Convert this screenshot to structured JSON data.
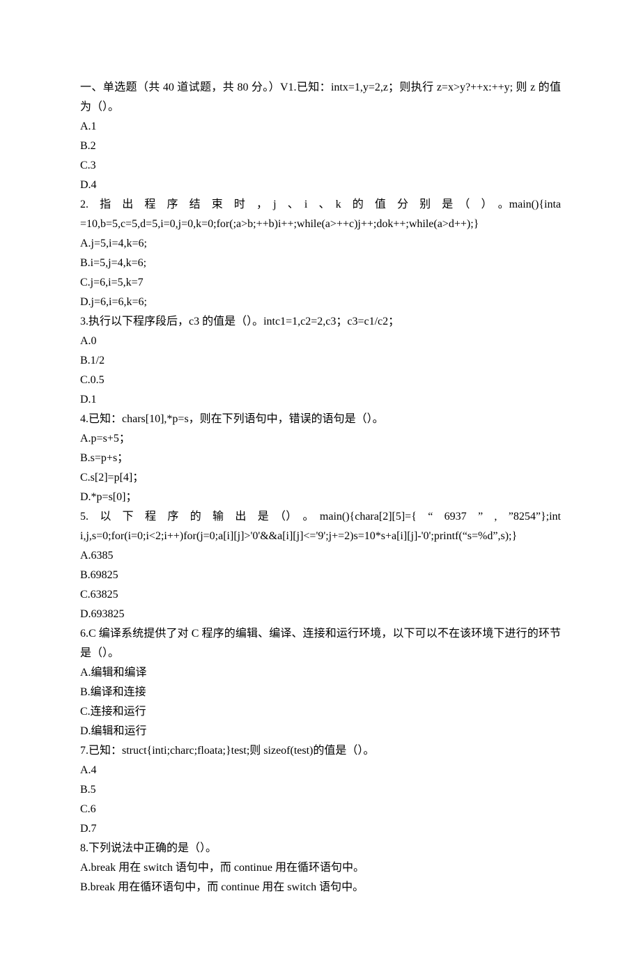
{
  "lines": [
    {
      "t": "一、单选题（共 40 道试题，共 80 分。）V1.已知：intx=1,y=2,z；则执行 z=x>y?++x:++y; 则 z 的值为（）。"
    },
    {
      "t": "A.1"
    },
    {
      "t": "B.2"
    },
    {
      "t": "C.3"
    },
    {
      "t": "D.4"
    },
    {
      "t": "2.　指　出　程　序　结　束　时　，　j　、　i　、　k　的　值　分　别　是　（　）　。main(){inta=10,b=5,c=5,d=5,i=0,j=0,k=0;for(;a>b;++b)i++;while(a>++c)j++;dok++;while(a>d++);}"
    },
    {
      "t": "A.j=5,i=4,k=6;"
    },
    {
      "t": "B.i=5,j=4,k=6;"
    },
    {
      "t": "C.j=6,i=5,k=7"
    },
    {
      "t": "D.j=6,i=6,k=6;"
    },
    {
      "t": "3.执行以下程序段后，c3 的值是（）。intc1=1,c2=2,c3；c3=c1/c2；"
    },
    {
      "t": "A.0"
    },
    {
      "t": "B.1/2"
    },
    {
      "t": "C.0.5"
    },
    {
      "t": "D.1"
    },
    {
      "t": "4.已知：chars[10],*p=s，则在下列语句中，错误的语句是（）。"
    },
    {
      "t": "A.p=s+5；"
    },
    {
      "t": "B.s=p+s；"
    },
    {
      "t": "C.s[2]=p[4]；"
    },
    {
      "t": "D.*p=s[0]；"
    },
    {
      "t": "5.　以　下　程　序　的　输　出　是　（）　。　main(){chara[2][5]={　“　6937　”　,　”8254”};inti,j,s=0;for(i=0;i<2;i++)for(j=0;a[i][j]>'0'&&a[i][j]<='9';j+=2)s=10*s+a[i][j]-'0';printf(“s=%d”,s);}"
    },
    {
      "t": "A.6385"
    },
    {
      "t": "B.69825"
    },
    {
      "t": "C.63825"
    },
    {
      "t": "D.693825"
    },
    {
      "t": "6.C 编译系统提供了对 C 程序的编辑、编译、连接和运行环境，以下可以不在该环境下进行的环节是（）。"
    },
    {
      "t": "A.编辑和编译"
    },
    {
      "t": "B.编译和连接"
    },
    {
      "t": "C.连接和运行"
    },
    {
      "t": "D.编辑和运行"
    },
    {
      "t": "7.已知：struct{inti;charc;floata;}test;则 sizeof(test)的值是（）。"
    },
    {
      "t": "A.4"
    },
    {
      "t": "B.5"
    },
    {
      "t": "C.6"
    },
    {
      "t": "D.7"
    },
    {
      "t": "8.下列说法中正确的是（）。"
    },
    {
      "t": "A.break 用在 switch 语句中，而 continue 用在循环语句中。"
    },
    {
      "t": "B.break 用在循环语句中，而 continue 用在 switch 语句中。"
    }
  ]
}
